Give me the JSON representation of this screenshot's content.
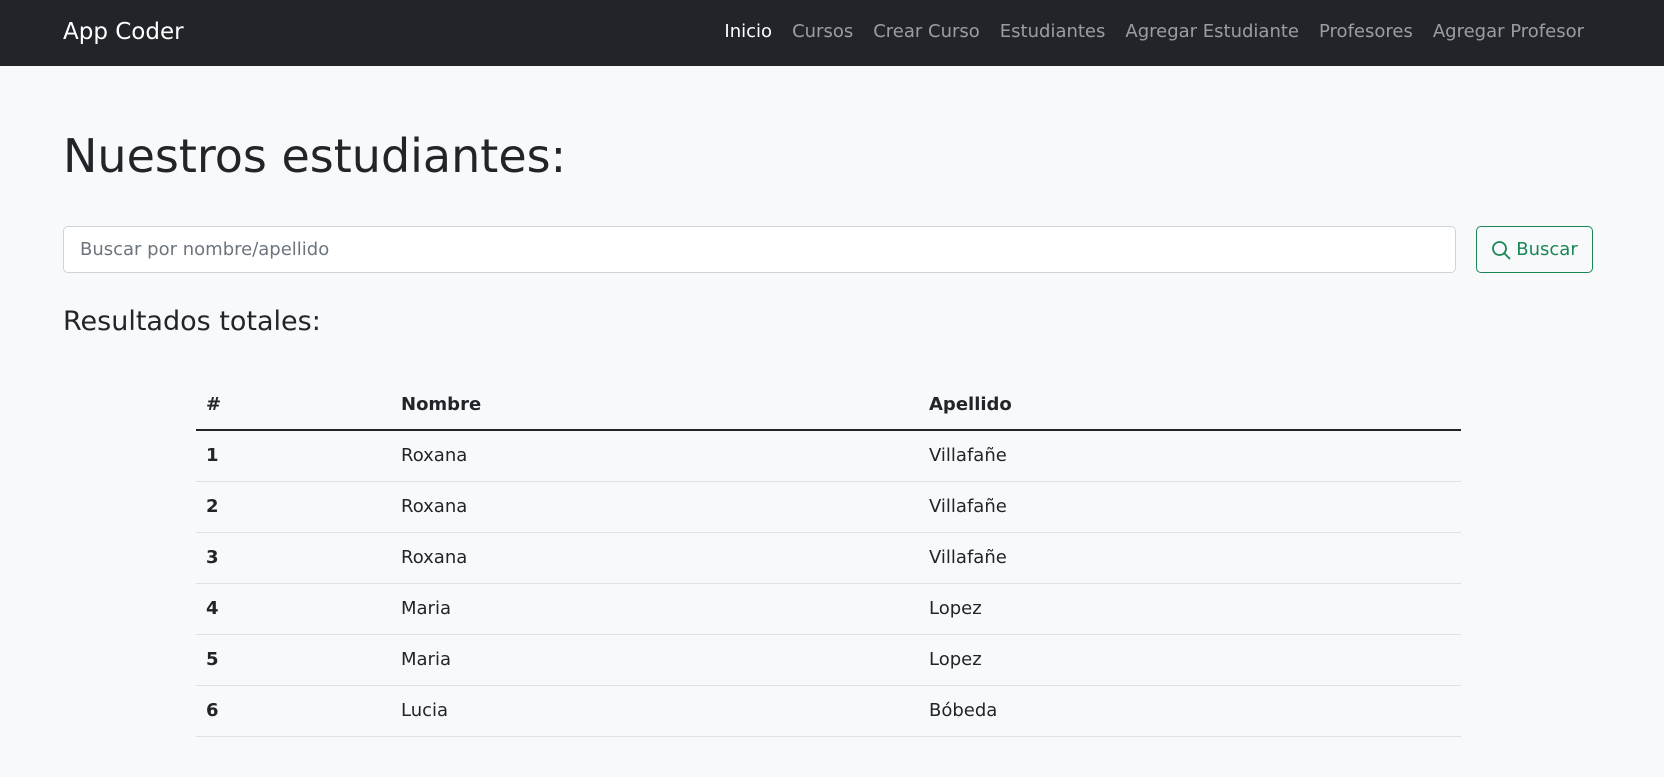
{
  "navbar": {
    "brand": "App Coder",
    "links": [
      {
        "label": "Inicio",
        "active": true
      },
      {
        "label": "Cursos",
        "active": false
      },
      {
        "label": "Crear Curso",
        "active": false
      },
      {
        "label": "Estudiantes",
        "active": false
      },
      {
        "label": "Agregar Estudiante",
        "active": false
      },
      {
        "label": "Profesores",
        "active": false
      },
      {
        "label": "Agregar Profesor",
        "active": false
      }
    ]
  },
  "main": {
    "title": "Nuestros estudiantes:",
    "search": {
      "placeholder": "Buscar por nombre/apellido",
      "value": "",
      "button_label": "Buscar",
      "button_icon": "search-icon"
    },
    "results_title": "Resultados totales:",
    "table": {
      "headers": [
        "#",
        "Nombre",
        "Apellido"
      ],
      "rows": [
        [
          "1",
          "Roxana",
          "Villafañe"
        ],
        [
          "2",
          "Roxana",
          "Villafañe"
        ],
        [
          "3",
          "Roxana",
          "Villafañe"
        ],
        [
          "4",
          "Maria",
          "Lopez"
        ],
        [
          "5",
          "Maria",
          "Lopez"
        ],
        [
          "6",
          "Lucia",
          "Bóbeda"
        ]
      ]
    }
  },
  "colors": {
    "navbar_bg": "#212529",
    "page_bg": "#f8f9fa",
    "success": "#198754"
  }
}
